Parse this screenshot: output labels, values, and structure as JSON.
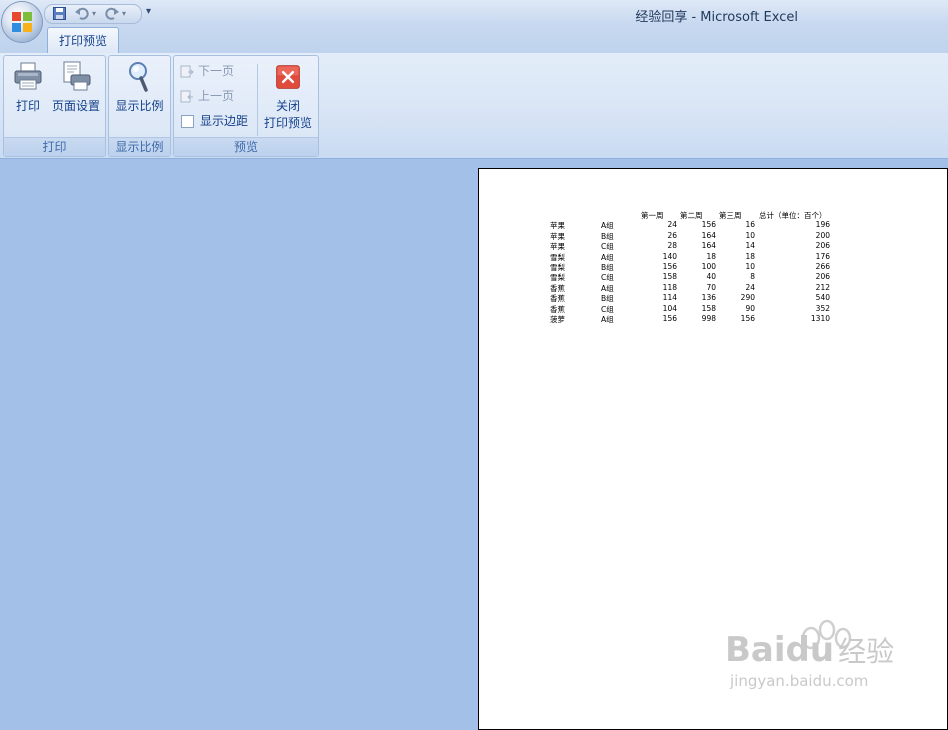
{
  "window": {
    "title": "经验回享 - Microsoft Excel"
  },
  "tabs": [
    {
      "label": "打印预览"
    }
  ],
  "ribbon": {
    "print_group": {
      "label": "打印",
      "print_btn": "打印",
      "page_setup_btn": "页面设置"
    },
    "zoom_group": {
      "label": "显示比例",
      "zoom_btn": "显示比例"
    },
    "preview_group": {
      "label": "预览",
      "next_page": "下一页",
      "prev_page": "上一页",
      "show_margins": "显示边距",
      "close_line1": "关闭",
      "close_line2": "打印预览"
    }
  },
  "sheet": {
    "headers": [
      "第一周",
      "第二周",
      "第三周",
      "总计（单位：百个）"
    ],
    "rows": [
      {
        "fruit": "苹果",
        "group": "A组",
        "w1": "24",
        "w2": "156",
        "w3": "16",
        "total": "196"
      },
      {
        "fruit": "苹果",
        "group": "B组",
        "w1": "26",
        "w2": "164",
        "w3": "10",
        "total": "200"
      },
      {
        "fruit": "苹果",
        "group": "C组",
        "w1": "28",
        "w2": "164",
        "w3": "14",
        "total": "206"
      },
      {
        "fruit": "雪梨",
        "group": "A组",
        "w1": "140",
        "w2": "18",
        "w3": "18",
        "total": "176"
      },
      {
        "fruit": "雪梨",
        "group": "B组",
        "w1": "156",
        "w2": "100",
        "w3": "10",
        "total": "266"
      },
      {
        "fruit": "雪梨",
        "group": "C组",
        "w1": "158",
        "w2": "40",
        "w3": "8",
        "total": "206"
      },
      {
        "fruit": "香蕉",
        "group": "A组",
        "w1": "118",
        "w2": "70",
        "w3": "24",
        "total": "212"
      },
      {
        "fruit": "香蕉",
        "group": "B组",
        "w1": "114",
        "w2": "136",
        "w3": "290",
        "total": "540"
      },
      {
        "fruit": "香蕉",
        "group": "C组",
        "w1": "104",
        "w2": "158",
        "w3": "90",
        "total": "352"
      },
      {
        "fruit": "菠萝",
        "group": "A组",
        "w1": "156",
        "w2": "998",
        "w3": "156",
        "total": "1310"
      }
    ]
  },
  "watermark": {
    "brand": "Bai",
    "brand2": "du",
    "cn": "经验",
    "url": "jingyan.baidu.com"
  }
}
